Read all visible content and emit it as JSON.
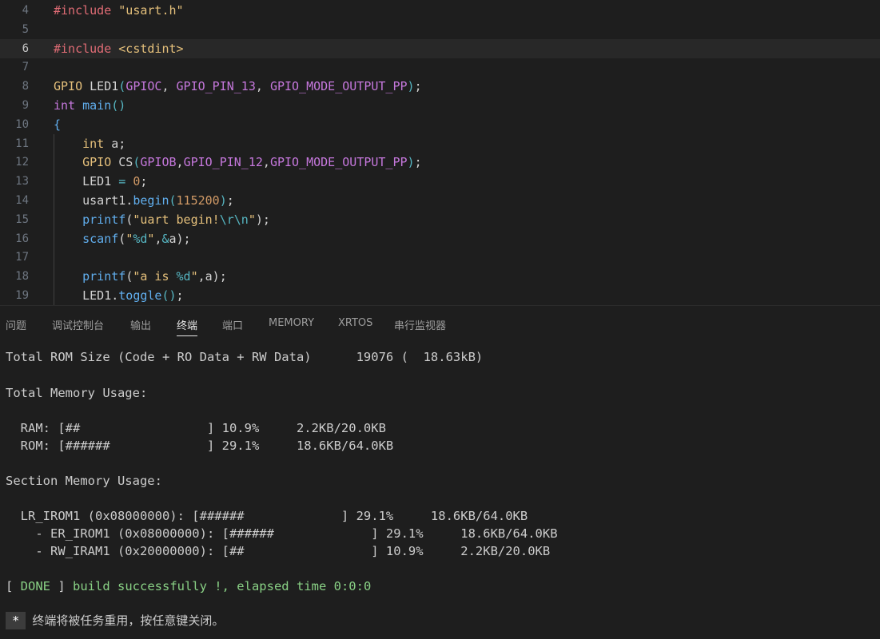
{
  "editor": {
    "current_line": 6,
    "lines": [
      {
        "num": "4",
        "tokens": [
          [
            "pp",
            "#include "
          ],
          [
            "str",
            "\"usart.h\""
          ]
        ]
      },
      {
        "num": "5",
        "tokens": []
      },
      {
        "num": "6",
        "tokens": [
          [
            "pp",
            "#include "
          ],
          [
            "str",
            "<cstdint>"
          ]
        ]
      },
      {
        "num": "7",
        "tokens": []
      },
      {
        "num": "8",
        "tokens": [
          [
            "str",
            "GPIO"
          ],
          [
            "plain",
            " "
          ],
          [
            "plain",
            "LED1"
          ],
          [
            "op",
            "("
          ],
          [
            "macro",
            "GPIOC"
          ],
          [
            "plain",
            ", "
          ],
          [
            "macro",
            "GPIO_PIN_13"
          ],
          [
            "plain",
            ", "
          ],
          [
            "macro",
            "GPIO_MODE_OUTPUT_PP"
          ],
          [
            "op",
            ")"
          ],
          [
            "plain",
            ";"
          ]
        ]
      },
      {
        "num": "9",
        "tokens": [
          [
            "type",
            "int"
          ],
          [
            "plain",
            " "
          ],
          [
            "fn",
            "main"
          ],
          [
            "op",
            "()"
          ]
        ]
      },
      {
        "num": "10",
        "tokens": [
          [
            "fn",
            "{"
          ]
        ]
      },
      {
        "num": "11",
        "tokens": [
          [
            "plain",
            "    "
          ],
          [
            "str",
            "int"
          ],
          [
            "plain",
            " a;"
          ]
        ]
      },
      {
        "num": "12",
        "tokens": [
          [
            "plain",
            "    "
          ],
          [
            "str",
            "GPIO"
          ],
          [
            "plain",
            " "
          ],
          [
            "plain",
            "CS"
          ],
          [
            "op",
            "("
          ],
          [
            "macro",
            "GPIOB"
          ],
          [
            "plain",
            ","
          ],
          [
            "macro",
            "GPIO_PIN_12"
          ],
          [
            "plain",
            ","
          ],
          [
            "macro",
            "GPIO_MODE_OUTPUT_PP"
          ],
          [
            "op",
            ")"
          ],
          [
            "plain",
            ";"
          ]
        ]
      },
      {
        "num": "13",
        "tokens": [
          [
            "plain",
            "    LED1 "
          ],
          [
            "op",
            "="
          ],
          [
            "plain",
            " "
          ],
          [
            "num",
            "0"
          ],
          [
            "plain",
            ";"
          ]
        ]
      },
      {
        "num": "14",
        "tokens": [
          [
            "plain",
            "    usart1."
          ],
          [
            "fn",
            "begin"
          ],
          [
            "op",
            "("
          ],
          [
            "num",
            "115200"
          ],
          [
            "op",
            ")"
          ],
          [
            "plain",
            ";"
          ]
        ]
      },
      {
        "num": "15",
        "tokens": [
          [
            "plain",
            "    "
          ],
          [
            "fn",
            "printf"
          ],
          [
            "plain",
            "("
          ],
          [
            "str",
            "\"uart begin!"
          ],
          [
            "esc",
            "\\r\\n"
          ],
          [
            "str",
            "\""
          ],
          [
            "plain",
            ");"
          ]
        ]
      },
      {
        "num": "16",
        "tokens": [
          [
            "plain",
            "    "
          ],
          [
            "fn",
            "scanf"
          ],
          [
            "plain",
            "("
          ],
          [
            "str",
            "\""
          ],
          [
            "esc",
            "%d"
          ],
          [
            "str",
            "\""
          ],
          [
            "plain",
            ","
          ],
          [
            "op",
            "&"
          ],
          [
            "plain",
            "a);"
          ]
        ]
      },
      {
        "num": "17",
        "tokens": []
      },
      {
        "num": "18",
        "tokens": [
          [
            "plain",
            "    "
          ],
          [
            "fn",
            "printf"
          ],
          [
            "plain",
            "("
          ],
          [
            "str",
            "\"a is "
          ],
          [
            "esc",
            "%d"
          ],
          [
            "str",
            "\""
          ],
          [
            "plain",
            ",a);"
          ]
        ]
      },
      {
        "num": "19",
        "tokens": [
          [
            "plain",
            "    LED1."
          ],
          [
            "fn",
            "toggle"
          ],
          [
            "op",
            "()"
          ],
          [
            "plain",
            ";"
          ]
        ]
      }
    ]
  },
  "panel": {
    "tabs": [
      {
        "label": "问题",
        "active": false
      },
      {
        "label": "调试控制台",
        "active": false
      },
      {
        "label": "输出",
        "active": false
      },
      {
        "label": "终端",
        "active": true
      },
      {
        "label": "端口",
        "active": false
      },
      {
        "label": "MEMORY",
        "active": false
      },
      {
        "label": "XRTOS",
        "active": false
      },
      {
        "label": "串行监视器",
        "active": false
      }
    ],
    "terminal": {
      "rom_size_line": "Total ROM Size (Code + RO Data + RW Data)      19076 (  18.63kB)",
      "memory_usage_title": "Total Memory Usage:",
      "ram_line": "  RAM: [##                 ] 10.9%     2.2KB/20.0KB",
      "rom_line": "  ROM: [######             ] 29.1%     18.6KB/64.0KB",
      "section_title": "Section Memory Usage:",
      "lr_irom1_line": "  LR_IROM1 (0x08000000): [######             ] 29.1%     18.6KB/64.0KB",
      "er_irom1_line": "    - ER_IROM1 (0x08000000): [######             ] 29.1%     18.6KB/64.0KB",
      "rw_iram1_line": "    - RW_IRAM1 (0x20000000): [##                 ] 10.9%     2.2KB/20.0KB",
      "done_open": "[ ",
      "done_tag": "DONE",
      "done_close": " ] ",
      "done_text": "build successfully !, elapsed time 0:0:0",
      "star": "*",
      "final_message": "终端将被任务重用，按任意键关闭。"
    }
  }
}
